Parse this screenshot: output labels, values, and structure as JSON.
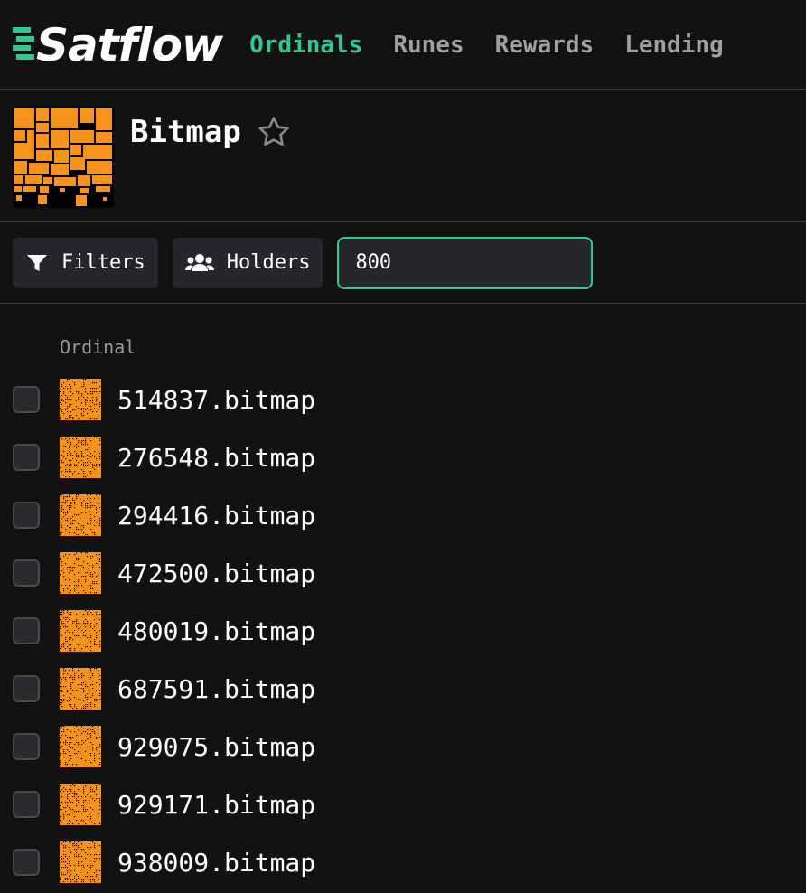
{
  "brand": {
    "name": "Satflow",
    "accent": "#2ec98f"
  },
  "nav": [
    {
      "label": "Ordinals",
      "active": true
    },
    {
      "label": "Runes",
      "active": false
    },
    {
      "label": "Rewards",
      "active": false
    },
    {
      "label": "Lending",
      "active": false
    }
  ],
  "collection": {
    "title": "Bitmap",
    "favorite_icon": "star-outline-icon",
    "thumb_color": "#f7931a"
  },
  "toolbar": {
    "filters_label": "Filters",
    "holders_label": "Holders",
    "search_value": "800"
  },
  "list": {
    "column_header": "Ordinal",
    "items": [
      "514837.bitmap",
      "276548.bitmap",
      "294416.bitmap",
      "472500.bitmap",
      "480019.bitmap",
      "687591.bitmap",
      "929075.bitmap",
      "929171.bitmap",
      "938009.bitmap"
    ]
  }
}
